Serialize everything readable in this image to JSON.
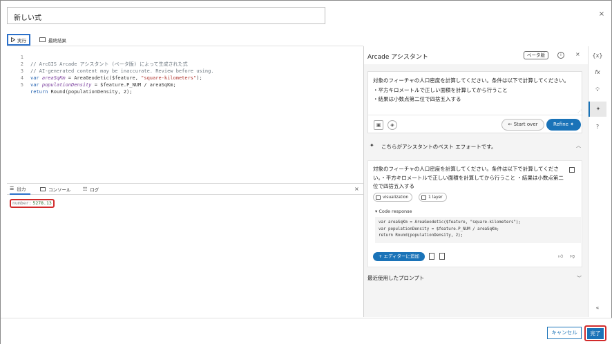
{
  "dialog": {
    "title_value": "新しい式",
    "close_symbol": "×"
  },
  "toolbar": {
    "run_label": "実行",
    "run_icon": "play-icon",
    "result_label": "最終結果"
  },
  "code_lines": [
    {
      "n": "1",
      "text": "// ArcGIS Arcade アシスタント (ベータ版) によって生成された式"
    },
    {
      "n": "2",
      "text": "// AI-generated content may be inaccurate. Review before using."
    },
    {
      "n": "3",
      "kw": "var ",
      "var": "areaSqKm",
      "rest": " = AreaGeodetic($feature, ",
      "str": "\"square-kilometers\"",
      "end": ");"
    },
    {
      "n": "4",
      "kw": "var ",
      "var": "populationDensity",
      "rest": " = $feature.P_NUM / areaSqKm;",
      "str": "",
      "end": ""
    },
    {
      "n": "5",
      "kw": "return ",
      "var": "",
      "rest": "Round(populationDensity, 2);",
      "str": "",
      "end": ""
    }
  ],
  "output": {
    "tabs": [
      "出力",
      "コンソール",
      "ログ"
    ],
    "number_key": "number:",
    "number_value": "5278.13",
    "close_symbol": "×"
  },
  "assistant": {
    "title": "Arcade アシスタント",
    "beta_badge": "ベータ版",
    "info_symbol": "i",
    "close_symbol": "×",
    "prompt_lines": [
      "対象のフィーチャの人口密度を計算してください。条件は以下で計算してください。",
      "・平方キロメートルで正しい面積を計算してから行うこと",
      "・結果は小数点第二位で四捨五入する"
    ],
    "start_over_label": "Start over",
    "refine_label": "Refine",
    "best_effort_label": "こちらがアシスタントのベスト エフォートです。",
    "response_text": "対象のフィーチャの人口密度を計算してください。条件は以下で計算してください。・平方キロメートルで正しい面積を計算してから行うこと ・結果は小数点第二位で四捨五入する",
    "chip_visualization": "visualization",
    "chip_layer": "1 layer",
    "code_response_label": "▾ Code response",
    "code_response": "var areaSqKm = AreaGeodetic($feature, \"square-kilometers\");\nvar populationDensity = $feature.P_NUM / areaSqKm;\nreturn Round(populationDensity, 2);",
    "add_to_editor_label": "+ エディターに追加",
    "recent_prompts_label": "最近使用したプロンプト"
  },
  "rail": {
    "items": [
      "{x}",
      "fx",
      "bulb-icon",
      "sparkle-icon",
      "help-icon"
    ],
    "collapse_symbol": "«"
  },
  "footer": {
    "cancel_label": "キャンセル",
    "done_label": "完了"
  },
  "colors": {
    "accent": "#1a73b8",
    "highlight_red": "#d12b2b"
  }
}
